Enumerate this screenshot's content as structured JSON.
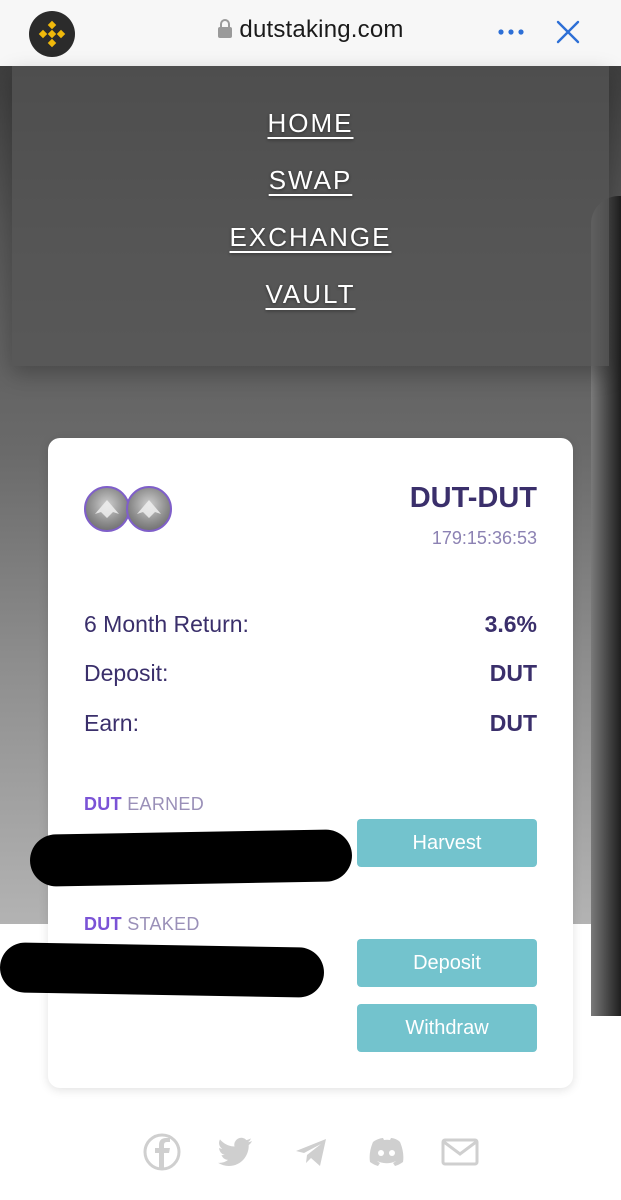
{
  "browser": {
    "url": "dutstaking.com",
    "logo_icon": "binance-logo-icon",
    "more_icon": "more-icon",
    "close_icon": "close-icon"
  },
  "nav": {
    "items": [
      {
        "label": "HOME"
      },
      {
        "label": "SWAP"
      },
      {
        "label": "EXCHANGE"
      },
      {
        "label": "VAULT"
      }
    ]
  },
  "pool": {
    "pair": "DUT-DUT",
    "timer": "179:15:36:53",
    "rows": [
      {
        "label": "6 Month Return:",
        "value": "3.6%"
      },
      {
        "label": "Deposit:",
        "value": "DUT"
      },
      {
        "label": "Earn:",
        "value": "DUT"
      }
    ],
    "earned": {
      "token": "DUT",
      "label": "EARNED",
      "button": "Harvest"
    },
    "staked": {
      "token": "DUT",
      "label": "STAKED",
      "deposit_button": "Deposit",
      "withdraw_button": "Withdraw"
    }
  },
  "colors": {
    "accent": "#73c3cd",
    "title": "#3a2f6b",
    "token": "#7b53d6"
  },
  "footer": {
    "icons": [
      "facebook-icon",
      "twitter-icon",
      "telegram-icon",
      "discord-icon",
      "mail-icon"
    ]
  }
}
